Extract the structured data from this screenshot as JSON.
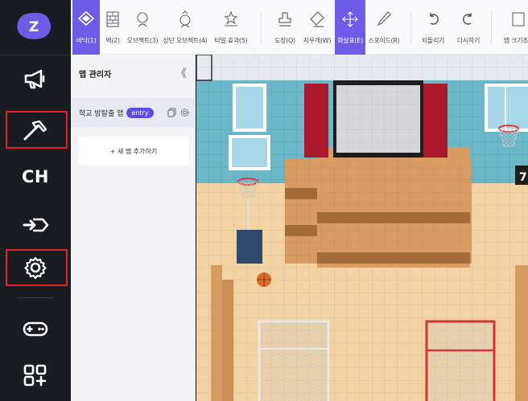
{
  "rail": {
    "logo": "zep-logo-icon",
    "items": [
      {
        "name": "megaphone-icon"
      },
      {
        "name": "hammer-icon"
      },
      {
        "label": "CH"
      },
      {
        "name": "portal-icon"
      },
      {
        "name": "gear-icon"
      },
      {
        "name": "gamepad-icon"
      },
      {
        "name": "apps-icon"
      }
    ],
    "highlight_color": "#e2212b"
  },
  "toolbar": {
    "tools": [
      {
        "label": "바닥(1)",
        "icon": "floor-icon",
        "active": true
      },
      {
        "label": "벽(2)",
        "icon": "wall-icon"
      },
      {
        "label": "오브젝트(3)",
        "icon": "object-icon"
      },
      {
        "label": "상단 오브젝트(4)",
        "icon": "top-object-icon"
      },
      {
        "label": "타일 효과(5)",
        "icon": "tile-effect-icon"
      },
      {
        "label": "도장(Q)",
        "icon": "stamp-icon"
      },
      {
        "label": "지우개(W)",
        "icon": "eraser-icon"
      },
      {
        "label": "화살표(E)",
        "icon": "move-icon",
        "active": true
      },
      {
        "label": "스포이드(R)",
        "icon": "eyedropper-icon"
      },
      {
        "label": "되돌리기",
        "icon": "undo-icon"
      },
      {
        "label": "다시하기",
        "icon": "redo-icon"
      },
      {
        "label": "맵 크기조",
        "icon": "map-size-icon"
      }
    ],
    "accent": "#6c5ce7"
  },
  "panel": {
    "title": "맵 관리자",
    "collapse": "《",
    "maps": [
      {
        "name": "학교 방탈출 맵",
        "badge": "entry"
      }
    ],
    "add_button": "+ 새 맵 추가하기"
  },
  "canvas": {
    "scoreboard_digit": "7"
  }
}
